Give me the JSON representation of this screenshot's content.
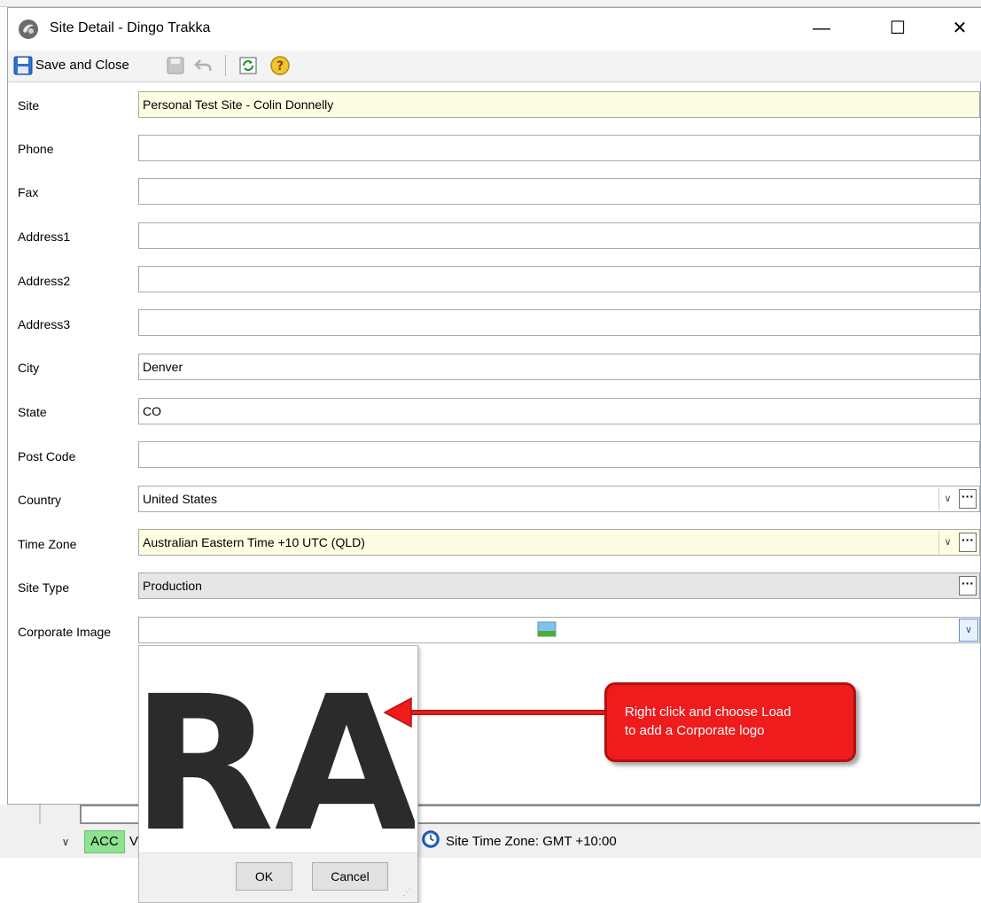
{
  "window": {
    "title": "Site Detail - Dingo Trakka",
    "minimize_glyph": "—",
    "maximize_glyph": "☐",
    "close_glyph": "✕"
  },
  "toolbar": {
    "save_close_label": "Save and Close",
    "icons": [
      "save-close-icon",
      "save-icon",
      "undo-icon",
      "refresh-icon",
      "help-icon"
    ]
  },
  "form": {
    "site": {
      "label": "Site",
      "value": "Personal Test Site - Colin Donnelly"
    },
    "phone": {
      "label": "Phone",
      "value": ""
    },
    "fax": {
      "label": "Fax",
      "value": ""
    },
    "address1": {
      "label": "Address1",
      "value": ""
    },
    "address2": {
      "label": "Address2",
      "value": ""
    },
    "address3": {
      "label": "Address3",
      "value": ""
    },
    "city": {
      "label": "City",
      "value": "Denver"
    },
    "state": {
      "label": "State",
      "value": "CO"
    },
    "post_code": {
      "label": "Post Code",
      "value": ""
    },
    "country": {
      "label": "Country",
      "value": "United States"
    },
    "time_zone": {
      "label": "Time Zone",
      "value": "Australian Eastern Time +10 UTC (QLD)"
    },
    "site_type": {
      "label": "Site Type",
      "value": "Production"
    },
    "corporate_image": {
      "label": "Corporate Image",
      "value": ""
    }
  },
  "popup": {
    "logo_text": "RA",
    "ok_label": "OK",
    "cancel_label": "Cancel"
  },
  "callout": {
    "line1": "Right click and choose Load",
    "line2": "to add a Corporate logo"
  },
  "background": {
    "acc_label": "ACC",
    "acc_tail": "V",
    "status_time_zone": "Site Time Zone: GMT +10:00"
  },
  "colors": {
    "required_field_bg": "#fffde1",
    "readonly_field_bg": "#e6e6e6",
    "callout_bg": "#ee1c1c",
    "acc_badge_bg": "#8fe28f"
  }
}
